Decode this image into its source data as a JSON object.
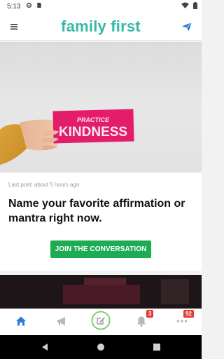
{
  "status_bar": {
    "time": "5:13"
  },
  "app_bar": {
    "logo_text": "family first"
  },
  "post": {
    "image_text_line1": "PRACTICE",
    "image_text_line2": "KINDNESS",
    "meta": "Last post: about 5 hours ago",
    "title": "Name your favorite affirmation or mantra right now.",
    "cta_label": "JOIN THE CONVERSATION"
  },
  "bottom_nav": {
    "notifications_badge": "3",
    "more_badge": "92"
  },
  "colors": {
    "brand": "#37b9a8",
    "cta": "#1dab53",
    "active_tab": "#2a7bd5",
    "badge": "#e53935"
  },
  "icons": [
    "settings-icon",
    "sim-icon",
    "wifi-icon",
    "battery-icon",
    "menu-icon",
    "send-icon",
    "home-icon",
    "megaphone-icon",
    "compose-icon",
    "bell-icon",
    "more-icon",
    "back-icon",
    "home-button-icon",
    "recents-icon"
  ]
}
